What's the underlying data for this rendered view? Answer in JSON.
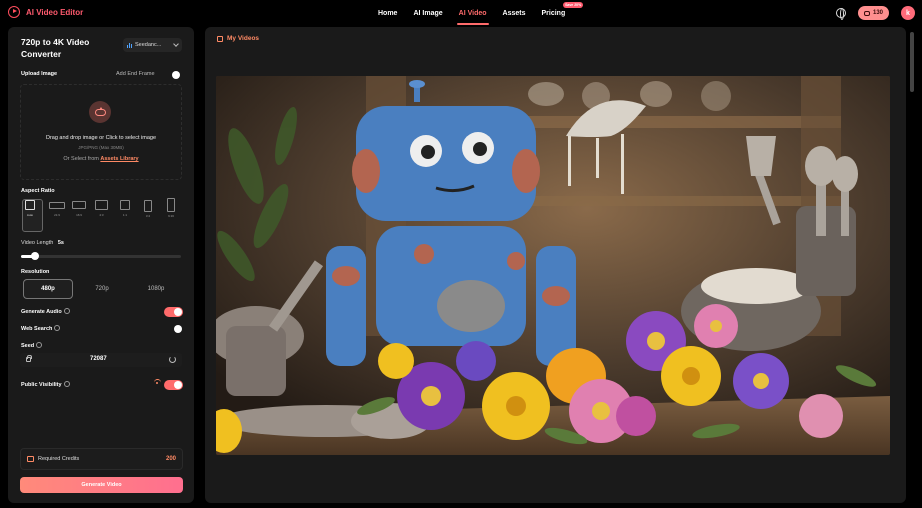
{
  "app": {
    "name": "AI Video Editor",
    "accent": "#ff5a6e"
  },
  "nav": [
    {
      "label": "Home",
      "active": false
    },
    {
      "label": "AI Image",
      "active": false
    },
    {
      "label": "AI Video",
      "active": true
    },
    {
      "label": "Assets",
      "active": false
    },
    {
      "label": "Pricing",
      "active": false,
      "badge": "Save 20%"
    }
  ],
  "header": {
    "credits": "130",
    "avatar_letter": "k",
    "globe_icon": "globe-icon"
  },
  "panel": {
    "title": "720p to 4K Video Converter",
    "model": "Seedanc...",
    "upload_label": "Upload Image",
    "end_frame_label": "Add End Frame",
    "end_frame_on": false,
    "drop_text": "Drag and drop image or Click to select image",
    "drop_hint": "JPG/PNG (Max 30MB)",
    "library_prefix": "Or Select from",
    "library_link": "Assets Library",
    "aspect_label": "Aspect Ratio",
    "aspect_ratios": [
      "Auto",
      "21:9",
      "16:9",
      "4:3",
      "1:1",
      "3:4",
      "9:16"
    ],
    "aspect_selected": "Auto",
    "video_length_label": "Video Length",
    "video_length_value": "5s",
    "video_length_level": 0.1,
    "resolution_label": "Resolution",
    "resolutions": [
      "480p",
      "720p",
      "1080p"
    ],
    "resolution_selected": "480p",
    "generate_audio_label": "Generate Audio",
    "generate_audio_on": true,
    "web_search_label": "Web Search",
    "web_search_on": false,
    "seed_label": "Seed",
    "seed_value": "72087",
    "public_visibility_label": "Public Visibility",
    "public_visibility_on": true,
    "required_credits_label": "Required Credits",
    "required_credits_value": "200",
    "generate_button": "Generate Video"
  },
  "main": {
    "section_title": "My Videos"
  }
}
